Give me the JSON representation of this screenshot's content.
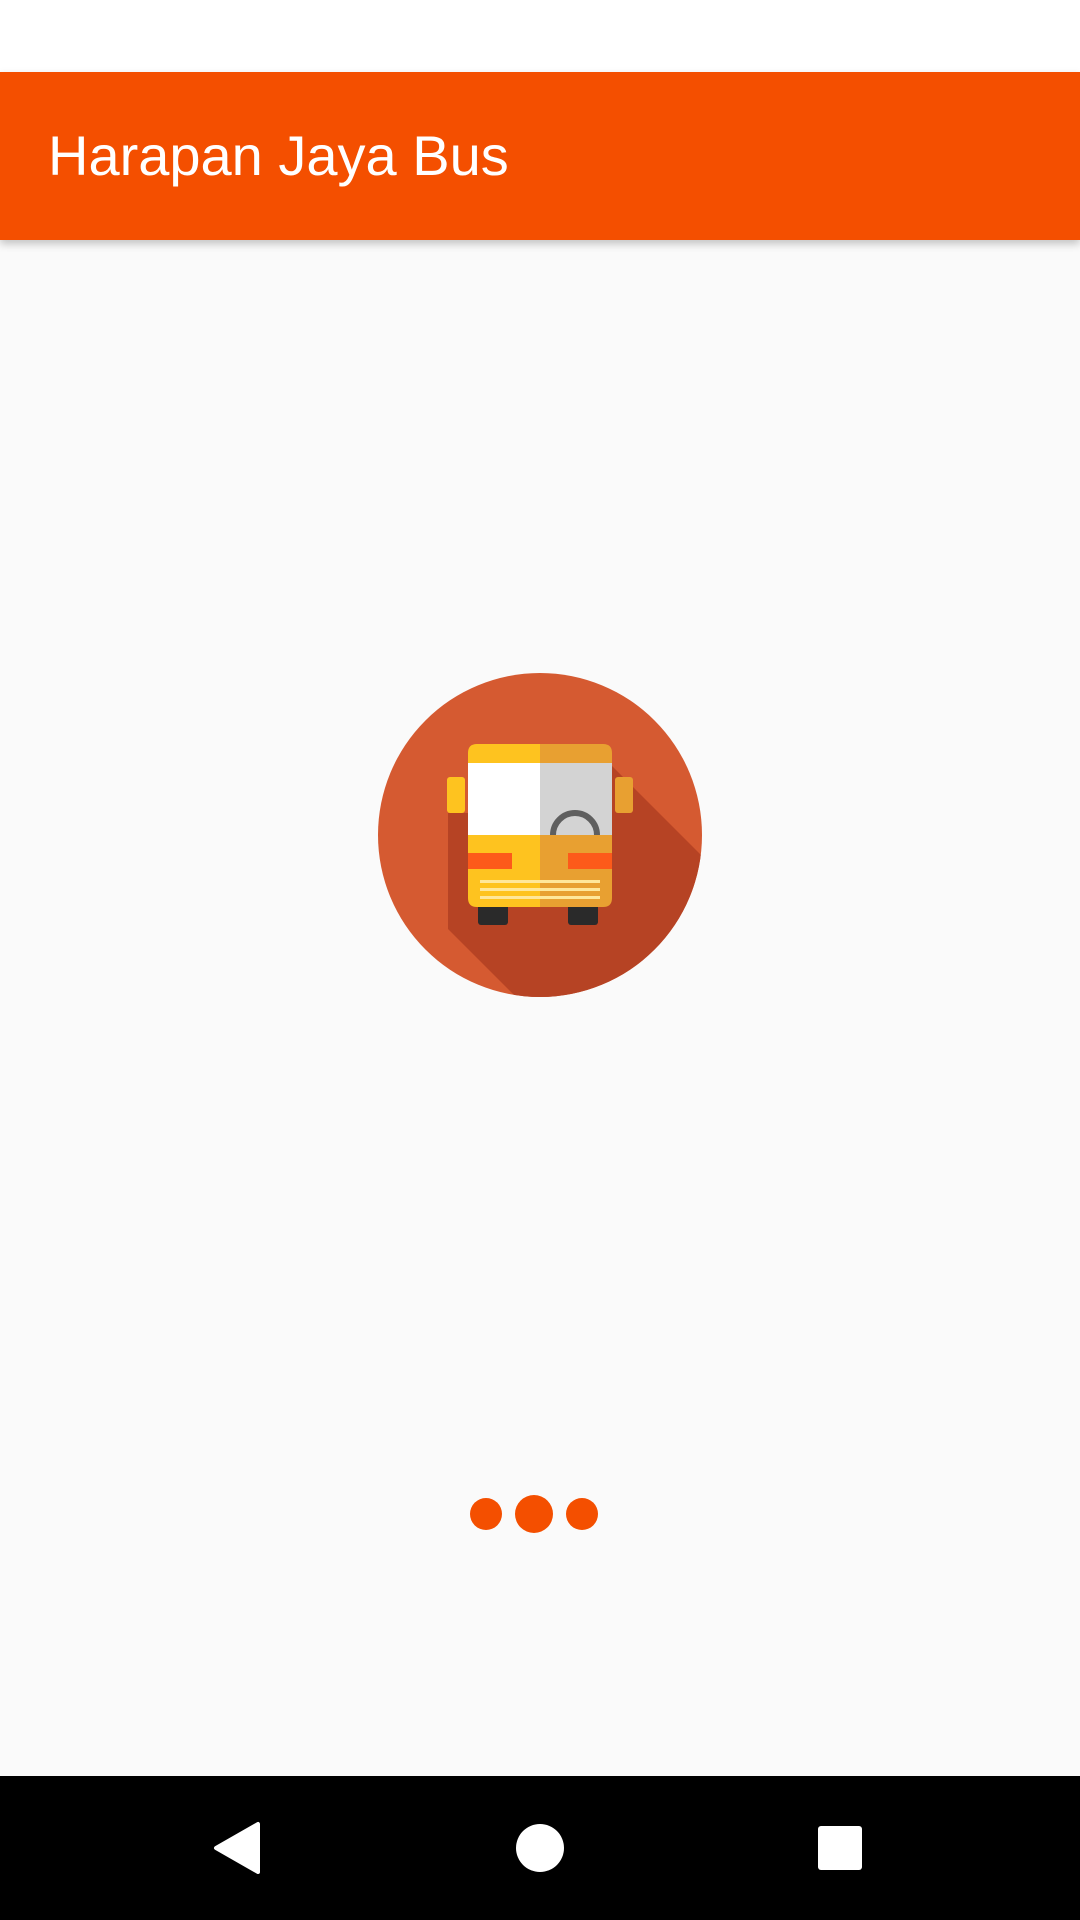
{
  "app_bar": {
    "title": "Harapan Jaya Bus",
    "background_color": "#f44f00"
  },
  "splash": {
    "logo_icon": "bus-front-icon",
    "loader_color": "#f44f00"
  },
  "nav_bar": {
    "back_icon": "back-icon",
    "home_icon": "home-icon",
    "recents_icon": "recents-icon"
  }
}
